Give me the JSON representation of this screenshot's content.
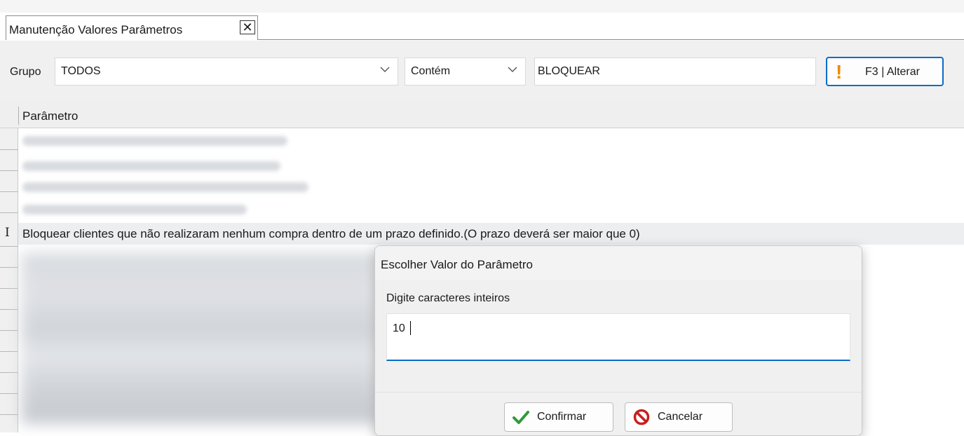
{
  "tab": {
    "title": "Manutenção Valores Parâmetros",
    "close_glyph": "✕"
  },
  "toolbar": {
    "grupo_label": "Grupo",
    "grupo_value": "TODOS",
    "filter_mode": "Contém",
    "search_value": "BLOQUEAR",
    "alter_button": "F3 | Alterar",
    "alter_icon": "exclamation-icon",
    "accent": "#0a6cc8",
    "warning_color": "#ee8a00"
  },
  "grid": {
    "column_header": "Parâmetro",
    "selected_row": "Bloquear clientes que não realizaram nenhum compra dentro de um prazo definido.(O prazo deverá ser maior que 0)",
    "row_marker": "I"
  },
  "dialog": {
    "title": "Escolher Valor do Parâmetro",
    "prompt": "Digite caracteres inteiros",
    "value": "10",
    "confirm_label": "Confirmar",
    "confirm_icon": "checkmark-icon",
    "cancel_label": "Cancelar",
    "cancel_icon": "prohibited-icon"
  }
}
